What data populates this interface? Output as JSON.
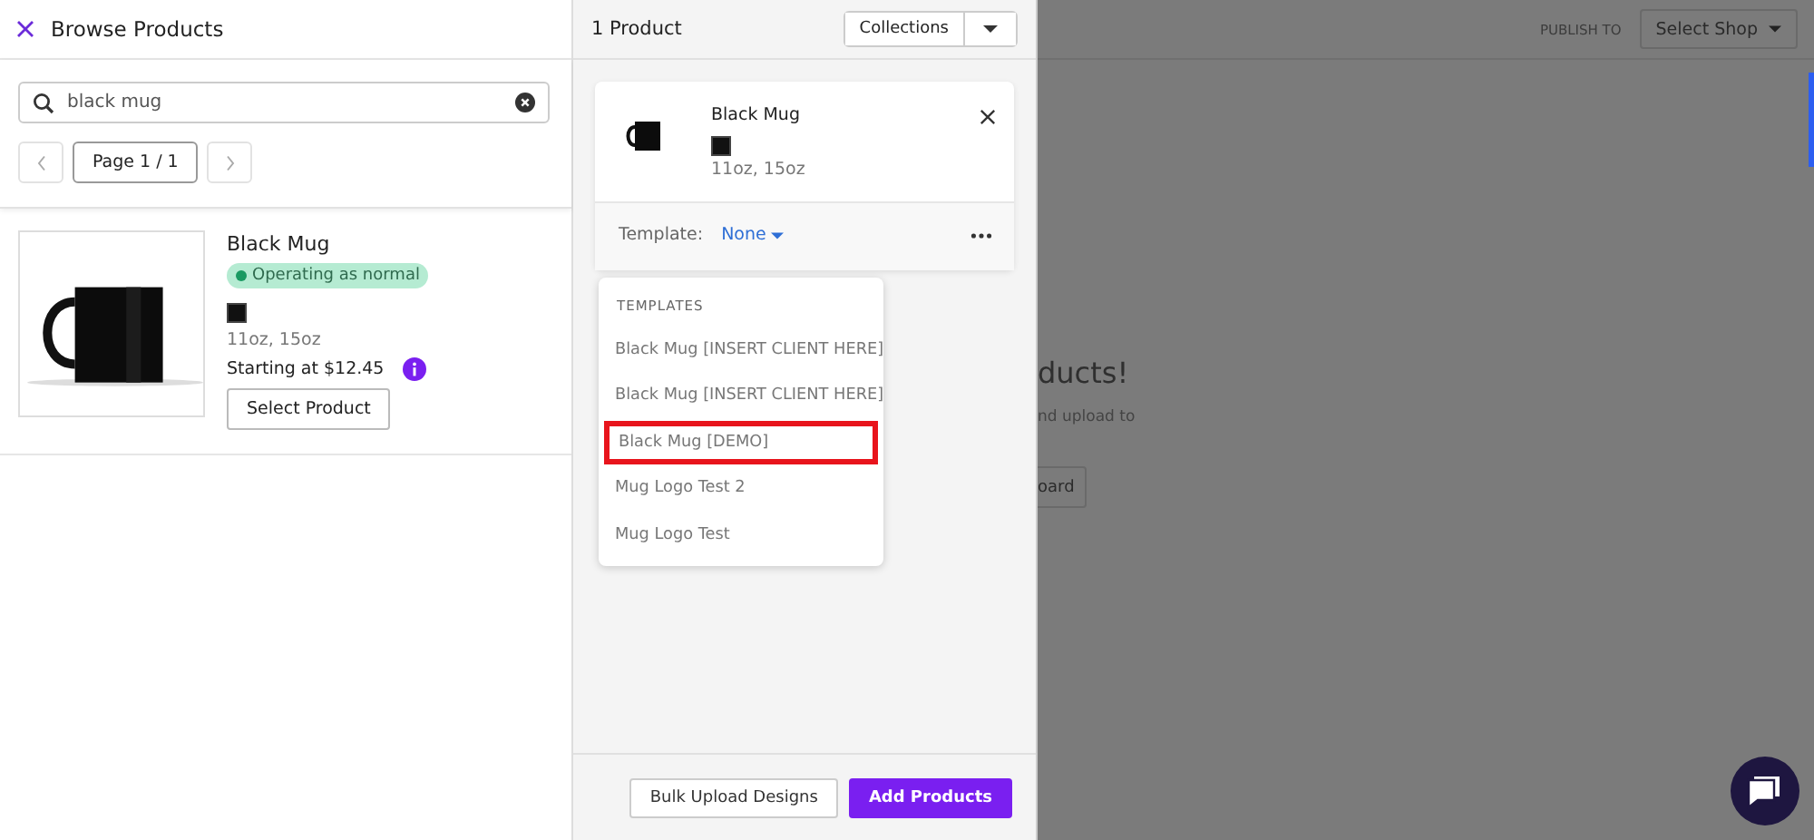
{
  "browse_panel": {
    "title": "Browse Products",
    "search": {
      "value": "black mug"
    },
    "pagination": {
      "label": "Page 1 / 1",
      "prev_disabled": true,
      "next_disabled": true
    },
    "products": [
      {
        "name": "Black Mug",
        "status": "Operating as normal",
        "sizes": "11oz, 15oz",
        "price": "Starting at $12.45",
        "button": "Select Product"
      }
    ]
  },
  "selected_panel": {
    "count": "1 Product",
    "collections_button": "Collections",
    "items": [
      {
        "name": "Black Mug",
        "sizes": "11oz, 15oz",
        "template_label": "Template:",
        "template_value": "None"
      }
    ],
    "template_menu": {
      "heading": "TEMPLATES",
      "items": [
        {
          "label": "Black Mug [INSERT CLIENT HERE]",
          "highlighted": false
        },
        {
          "label": "Black Mug [INSERT CLIENT HERE]",
          "highlighted": false
        },
        {
          "label": "Black Mug [DEMO]",
          "highlighted": true
        },
        {
          "label": "Mug Logo Test 2",
          "highlighted": false
        },
        {
          "label": "Mug Logo Test",
          "highlighted": false
        }
      ]
    },
    "buttons": [
      {
        "label": "Bulk Upload Designs",
        "kind": "secondary"
      },
      {
        "label": "Add Products",
        "kind": "primary"
      }
    ]
  },
  "background_page": {
    "publish_label": "PUBLISH TO",
    "shop_select": "Select Shop",
    "heading": "ducts!",
    "text": "nd upload to",
    "button": "oard"
  }
}
